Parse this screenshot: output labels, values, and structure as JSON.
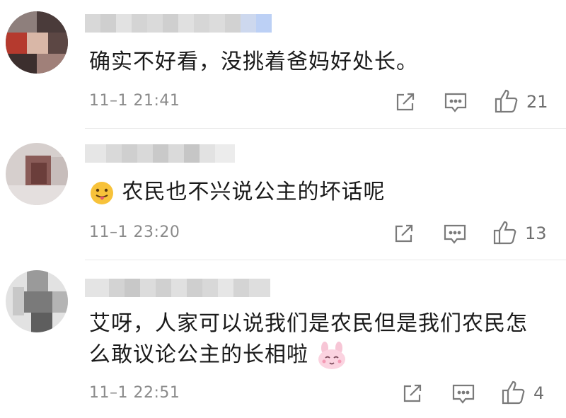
{
  "comments": [
    {
      "text_lines": [
        "确实不好看，没挑着爸妈好处长。"
      ],
      "time": "11–1 21:41",
      "likes": "21",
      "emoji": null
    },
    {
      "text_lines": [
        "农民也不兴说公主的坏话呢"
      ],
      "time": "11–1 23:20",
      "likes": "13",
      "emoji": "tongue-out-emoji"
    },
    {
      "text_lines": [
        "艾呀，人家可以说我们是农民但是我们农民怎",
        "么敢议论公主的长相啦"
      ],
      "time": "11–1 22:51",
      "likes": "4",
      "emoji": "pink-bunny-emoji"
    }
  ],
  "icons": {
    "share": "share-icon",
    "reply": "comment-icon",
    "like": "thumbs-up-icon"
  },
  "colors": {
    "text": "#1a1a1a",
    "meta": "#8a8a8a",
    "icon": "#7a7a7a"
  }
}
